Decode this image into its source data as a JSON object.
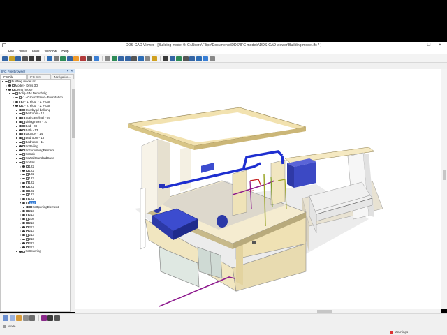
{
  "window": {
    "title": "DDS-CAD Viewer - [Building model  0: C:\\Users\\Filipe\\Documents\\DDS\\IFC models\\DDS-CAD viewer\\Building model.ifc * ]",
    "minimize": "—",
    "maximize": "☐",
    "close": "✕"
  },
  "menu": [
    "File",
    "View",
    "Tools",
    "Window",
    "Help"
  ],
  "toolbar": {
    "icons": [
      "new-icon",
      "open-icon",
      "save-icon",
      "print-icon",
      "undo-icon",
      "redo-icon",
      "select-icon",
      "orbit-icon",
      "pan-icon",
      "zoom-icon",
      "fit-icon",
      "section-icon",
      "walk-icon",
      "measure-icon",
      "view-icon",
      "home-icon",
      "front-icon",
      "top-icon",
      "iso-icon",
      "render-icon",
      "camera-icon",
      "render2-icon",
      "filter-icon",
      "layers-icon",
      "properties-icon",
      "search-icon",
      "check-icon",
      "report-icon",
      "bcf-icon",
      "settings-icon"
    ],
    "colors": [
      "#3465a4",
      "#c9a227",
      "#3465a4",
      "#555555",
      "#3a3a3a",
      "#3a3a3a",
      "#2d6db5",
      "#7b7b7b",
      "#2e8b57",
      "#3465a4",
      "#ef9a2a",
      "#b23b3b",
      "#555555",
      "#3a7fd5",
      "#888888",
      "#2e8b57",
      "#3465a4",
      "#3465a4",
      "#555555",
      "#2d6db5",
      "#888888",
      "#d0a020",
      "#3a3a3a",
      "#3465a4",
      "#2e8b57",
      "#555555",
      "#3465a4",
      "#2d6db5",
      "#3a7fd5",
      "#888888"
    ]
  },
  "panel": {
    "header": "IFC File Browser",
    "tabs": [
      "IFC File brows..",
      "IFC Set Insp..",
      "Navigation..."
    ],
    "tree": [
      {
        "indent": 0,
        "label": "Building model.ifc",
        "expanded": true
      },
      {
        "indent": 1,
        "label": "Model - Dims 3D"
      },
      {
        "indent": 1,
        "label": "Demo house",
        "expanded": true
      },
      {
        "indent": 2,
        "label": "Bolig-BIM Demobolig",
        "expanded": true
      },
      {
        "indent": 3,
        "label": "-1 - GroundFloor - Foundation"
      },
      {
        "indent": 3,
        "label": "0 - 1. Floor - 1. Floor"
      },
      {
        "indent": 3,
        "label": "1 - 2. Floor - 2. Floor",
        "expanded": true
      },
      {
        "indent": 4,
        "label": "Overbygd balkong"
      },
      {
        "indent": 4,
        "label": "Bedroom - 12"
      },
      {
        "indent": 4,
        "label": "Staircase/hall - 09"
      },
      {
        "indent": 4,
        "label": "Living room - 10"
      },
      {
        "indent": 4,
        "label": "Bod - 08"
      },
      {
        "indent": 4,
        "label": "Bath - 13"
      },
      {
        "indent": 4,
        "label": "Laundry - 14"
      },
      {
        "indent": 4,
        "label": "Bedroom - 13"
      },
      {
        "indent": 4,
        "label": "Bedroom - 11"
      },
      {
        "indent": 4,
        "label": "IfcRailing"
      },
      {
        "indent": 4,
        "label": "IfcFurnishingElement"
      },
      {
        "indent": 4,
        "label": "IfcSlab"
      },
      {
        "indent": 4,
        "label": "IfcWallStandardCase"
      },
      {
        "indent": 4,
        "label": "IfcWall",
        "expanded": true
      },
      {
        "indent": 5,
        "label": "122"
      },
      {
        "indent": 5,
        "label": "122"
      },
      {
        "indent": 5,
        "label": "122"
      },
      {
        "indent": 5,
        "label": "122"
      },
      {
        "indent": 5,
        "label": "122"
      },
      {
        "indent": 5,
        "label": "122"
      },
      {
        "indent": 5,
        "label": "122"
      },
      {
        "indent": 5,
        "label": "122"
      },
      {
        "indent": 5,
        "label": "122"
      },
      {
        "indent": 5,
        "label": "213",
        "selected": true,
        "expanded": true
      },
      {
        "indent": 6,
        "label": "IfcOpeningElement"
      },
      {
        "indent": 5,
        "label": "213"
      },
      {
        "indent": 5,
        "label": "213"
      },
      {
        "indent": 5,
        "label": "208"
      },
      {
        "indent": 5,
        "label": "213"
      },
      {
        "indent": 5,
        "label": "213"
      },
      {
        "indent": 5,
        "label": "213"
      },
      {
        "indent": 5,
        "label": "213"
      },
      {
        "indent": 5,
        "label": "213"
      },
      {
        "indent": 5,
        "label": "222"
      },
      {
        "indent": 5,
        "label": "213"
      },
      {
        "indent": 4,
        "label": "IfcCovering"
      }
    ]
  },
  "status": {
    "left": "Mode",
    "right": "Warnings"
  }
}
